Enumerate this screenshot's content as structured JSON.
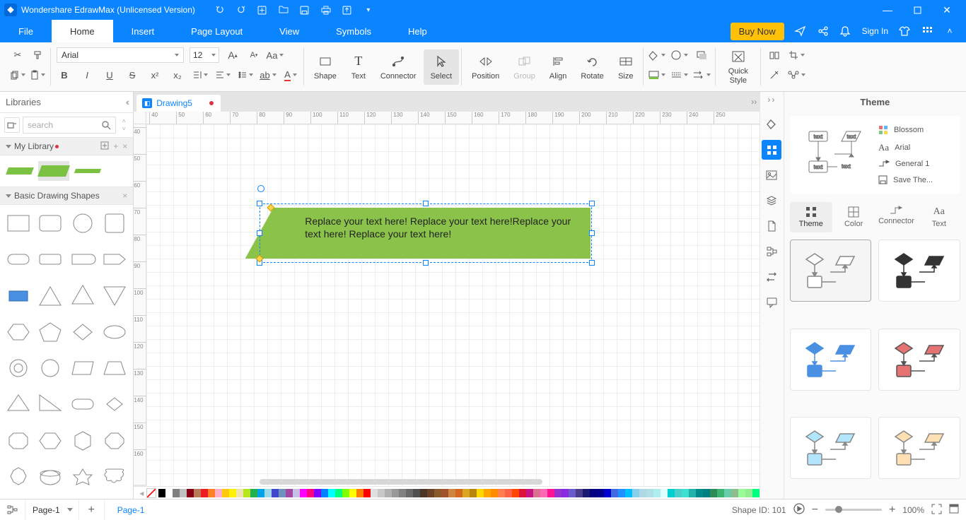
{
  "app": {
    "title": "Wondershare EdrawMax (Unlicensed Version)"
  },
  "menu": {
    "file": "File",
    "home": "Home",
    "insert": "Insert",
    "page_layout": "Page Layout",
    "view": "View",
    "symbols": "Symbols",
    "help": "Help",
    "buy_now": "Buy Now",
    "sign_in": "Sign In"
  },
  "ribbon": {
    "font": "Arial",
    "size": "12",
    "shape": "Shape",
    "text": "Text",
    "connector": "Connector",
    "select": "Select",
    "position": "Position",
    "group": "Group",
    "align": "Align",
    "rotate": "Rotate",
    "size_btn": "Size",
    "quick_style": "Quick\nStyle"
  },
  "libraries": {
    "title": "Libraries",
    "search_ph": "search",
    "my_library": "My Library",
    "basic_shapes": "Basic Drawing Shapes"
  },
  "doc": {
    "tab": "Drawing5",
    "shape_text": "Replace your text here!   Replace your text here!Replace your text here!   Replace your text here!"
  },
  "theme_panel": {
    "title": "Theme",
    "props": {
      "colors": "Blossom",
      "font": "Arial",
      "connector": "General 1",
      "save": "Save The..."
    },
    "tabs": {
      "theme": "Theme",
      "color": "Color",
      "connector": "Connector",
      "text": "Text"
    }
  },
  "status": {
    "page": "Page-1",
    "page_tab": "Page-1",
    "shape_id": "Shape ID: 101",
    "zoom": "100%"
  },
  "ruler_h": [
    40,
    50,
    60,
    70,
    80,
    90,
    100,
    110,
    120,
    130,
    140,
    150,
    160,
    170,
    180,
    190,
    200,
    210,
    220,
    230,
    240,
    250
  ],
  "ruler_v": [
    40,
    50,
    60,
    70,
    80,
    90,
    100,
    110,
    120,
    130,
    140,
    150,
    160
  ],
  "colors": [
    "#000000",
    "#ffffff",
    "#7f7f7f",
    "#c0c0c0",
    "#880015",
    "#b97a57",
    "#ed1c24",
    "#ff7f27",
    "#ffaec9",
    "#ffc90e",
    "#fff200",
    "#efe4b0",
    "#b5e61d",
    "#22b14c",
    "#00a2e8",
    "#99d9ea",
    "#3f48cc",
    "#7092be",
    "#a349a4",
    "#c8bfe7",
    "#ff00ff",
    "#ff0080",
    "#8000ff",
    "#0080ff",
    "#00ffff",
    "#00ff80",
    "#80ff00",
    "#ffff00",
    "#ff8000",
    "#ff0000",
    "#e0e0e0",
    "#c8c8c8",
    "#b0b0b0",
    "#989898",
    "#808080",
    "#686868",
    "#505050",
    "#4a3526",
    "#6b4226",
    "#8b5a2b",
    "#a0522d",
    "#cd853f",
    "#d2691e",
    "#daa520",
    "#b8860b",
    "#ffd700",
    "#ffa500",
    "#ff8c00",
    "#ff7f50",
    "#ff6347",
    "#ff4500",
    "#dc143c",
    "#c71585",
    "#db7093",
    "#ff69b4",
    "#ff1493",
    "#9932cc",
    "#8a2be2",
    "#6a5acd",
    "#483d8b",
    "#191970",
    "#000080",
    "#00008b",
    "#0000cd",
    "#4169e1",
    "#1e90ff",
    "#00bfff",
    "#87ceeb",
    "#add8e6",
    "#b0e0e6",
    "#afeeee",
    "#e0ffff",
    "#00ced1",
    "#48d1cc",
    "#40e0d0",
    "#20b2aa",
    "#008b8b",
    "#008080",
    "#2e8b57",
    "#3cb371",
    "#66cdaa",
    "#8fbc8f",
    "#98fb98",
    "#90ee90",
    "#00ff7f"
  ]
}
